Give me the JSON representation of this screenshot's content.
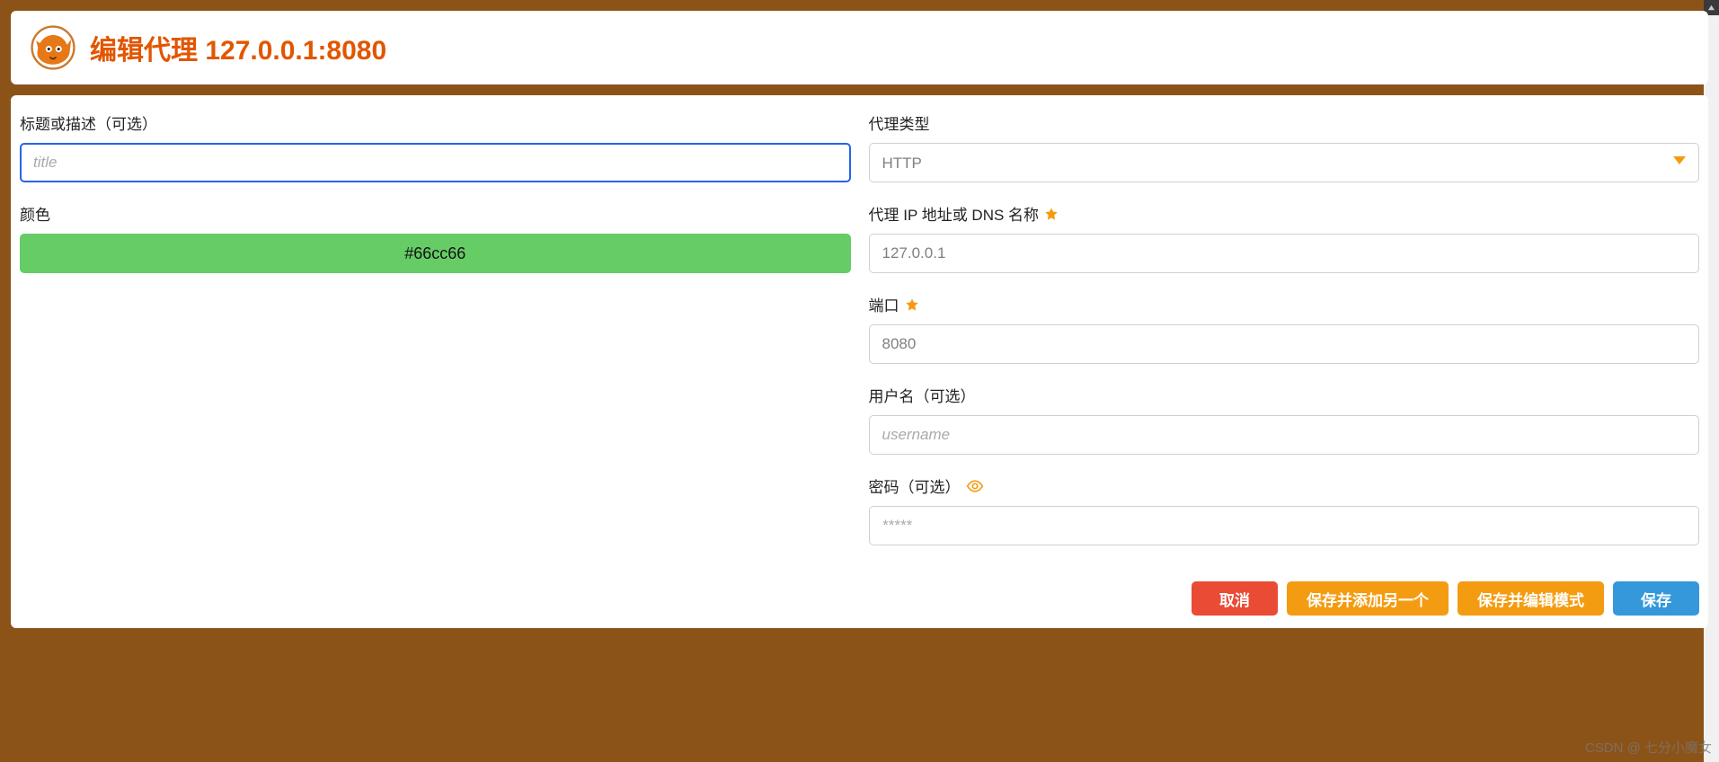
{
  "header": {
    "title": "编辑代理 127.0.0.1:8080"
  },
  "left": {
    "title_label": "标题或描述（可选）",
    "title_placeholder": "title",
    "title_value": "",
    "color_label": "颜色",
    "color_value": "#66cc66"
  },
  "right": {
    "proxy_type_label": "代理类型",
    "proxy_type_value": "HTTP",
    "proxy_ip_label": "代理 IP 地址或 DNS 名称",
    "proxy_ip_value": "127.0.0.1",
    "port_label": "端口",
    "port_value": "8080",
    "username_label": "用户名（可选）",
    "username_placeholder": "username",
    "username_value": "",
    "password_label": "密码（可选）",
    "password_placeholder": "*****",
    "password_value": ""
  },
  "buttons": {
    "cancel": "取消",
    "save_add_another": "保存并添加另一个",
    "save_edit_mode": "保存并编辑模式",
    "save": "保存"
  },
  "icons": {
    "star": "star-icon",
    "eye": "eye-icon",
    "caret_down": "chevron-down-icon"
  },
  "colors": {
    "accent_orange": "#e25600",
    "required_star": "#f39c12",
    "swatch_bg": "#66cc66"
  },
  "watermark": "CSDN @ 七分小魔女"
}
